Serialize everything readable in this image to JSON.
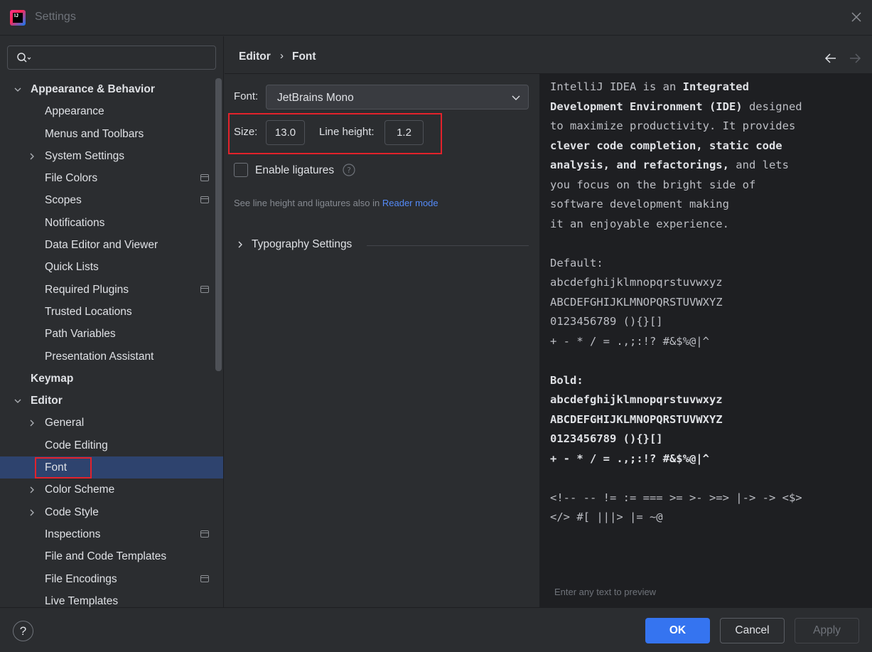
{
  "window": {
    "title": "Settings",
    "logo_text": "IJ"
  },
  "search": {
    "placeholder": "",
    "value": ""
  },
  "tree": [
    {
      "label": "Appearance & Behavior",
      "level": 0,
      "bold": true,
      "arrow": "down"
    },
    {
      "label": "Appearance",
      "level": 1
    },
    {
      "label": "Menus and Toolbars",
      "level": 1
    },
    {
      "label": "System Settings",
      "level": 1,
      "arrow": "right"
    },
    {
      "label": "File Colors",
      "level": 1,
      "project_icon": true
    },
    {
      "label": "Scopes",
      "level": 1,
      "project_icon": true
    },
    {
      "label": "Notifications",
      "level": 1
    },
    {
      "label": "Data Editor and Viewer",
      "level": 1
    },
    {
      "label": "Quick Lists",
      "level": 1
    },
    {
      "label": "Required Plugins",
      "level": 1,
      "project_icon": true
    },
    {
      "label": "Trusted Locations",
      "level": 1
    },
    {
      "label": "Path Variables",
      "level": 1
    },
    {
      "label": "Presentation Assistant",
      "level": 1
    },
    {
      "label": "Keymap",
      "level": 0,
      "bold": true
    },
    {
      "label": "Editor",
      "level": 0,
      "bold": true,
      "arrow": "down"
    },
    {
      "label": "General",
      "level": 1,
      "arrow": "right"
    },
    {
      "label": "Code Editing",
      "level": 1
    },
    {
      "label": "Font",
      "level": 1,
      "selected": true
    },
    {
      "label": "Color Scheme",
      "level": 1,
      "arrow": "right"
    },
    {
      "label": "Code Style",
      "level": 1,
      "arrow": "right"
    },
    {
      "label": "Inspections",
      "level": 1,
      "project_icon": true
    },
    {
      "label": "File and Code Templates",
      "level": 1
    },
    {
      "label": "File Encodings",
      "level": 1,
      "project_icon": true
    },
    {
      "label": "Live Templates",
      "level": 1
    }
  ],
  "breadcrumb": {
    "parent": "Editor",
    "separator": "›",
    "current": "Font"
  },
  "font_settings": {
    "font_label": "Font:",
    "font_value": "JetBrains Mono",
    "size_label": "Size:",
    "size_value": "13.0",
    "line_height_label": "Line height:",
    "line_height_value": "1.2",
    "ligatures_label": "Enable ligatures",
    "ligatures_checked": false,
    "hint_prefix": "See line height and ligatures also in ",
    "hint_link": "Reader mode",
    "typography_label": "Typography Settings"
  },
  "preview": {
    "lines": [
      [
        {
          "t": "IntelliJ IDEA is an "
        },
        {
          "t": "Integrated",
          "b": true
        }
      ],
      [
        {
          "t": "Development Environment (IDE)",
          "b": true
        },
        {
          "t": " designed"
        }
      ],
      [
        {
          "t": "to maximize productivity. It provides"
        }
      ],
      [
        {
          "t": "clever code completion, static code",
          "b": true
        }
      ],
      [
        {
          "t": "analysis, and refactorings,",
          "b": true
        },
        {
          "t": " and lets"
        }
      ],
      [
        {
          "t": "you focus on the bright side of"
        }
      ],
      [
        {
          "t": "software development making"
        }
      ],
      [
        {
          "t": "it an enjoyable experience."
        }
      ],
      [
        {
          "t": ""
        }
      ],
      [
        {
          "t": "Default:"
        }
      ],
      [
        {
          "t": "abcdefghijklmnopqrstuvwxyz"
        }
      ],
      [
        {
          "t": "ABCDEFGHIJKLMNOPQRSTUVWXYZ"
        }
      ],
      [
        {
          "t": "0123456789 (){}[]"
        }
      ],
      [
        {
          "t": "+ - * / = .,;:!? #&$%@|^"
        }
      ],
      [
        {
          "t": ""
        }
      ],
      [
        {
          "t": "Bold:",
          "b": true
        }
      ],
      [
        {
          "t": "abcdefghijklmnopqrstuvwxyz",
          "b": true
        }
      ],
      [
        {
          "t": "ABCDEFGHIJKLMNOPQRSTUVWXYZ",
          "b": true
        }
      ],
      [
        {
          "t": "0123456789 (){}[]",
          "b": true
        }
      ],
      [
        {
          "t": "+ - * / = .,;:!? #&$%@|^",
          "b": true
        }
      ],
      [
        {
          "t": ""
        }
      ],
      [
        {
          "t": "<!-- -- != := === >= >- >=> |-> -> <$>"
        }
      ],
      [
        {
          "t": "</> #[ |||> |= ~@"
        }
      ]
    ],
    "placeholder": "Enter any text to preview"
  },
  "footer": {
    "help_label": "?",
    "ok_label": "OK",
    "cancel_label": "Cancel",
    "apply_label": "Apply"
  },
  "colors": {
    "accent": "#3574f0",
    "selection": "#2e436e",
    "highlight_box": "#e3222b",
    "link": "#548af7"
  }
}
